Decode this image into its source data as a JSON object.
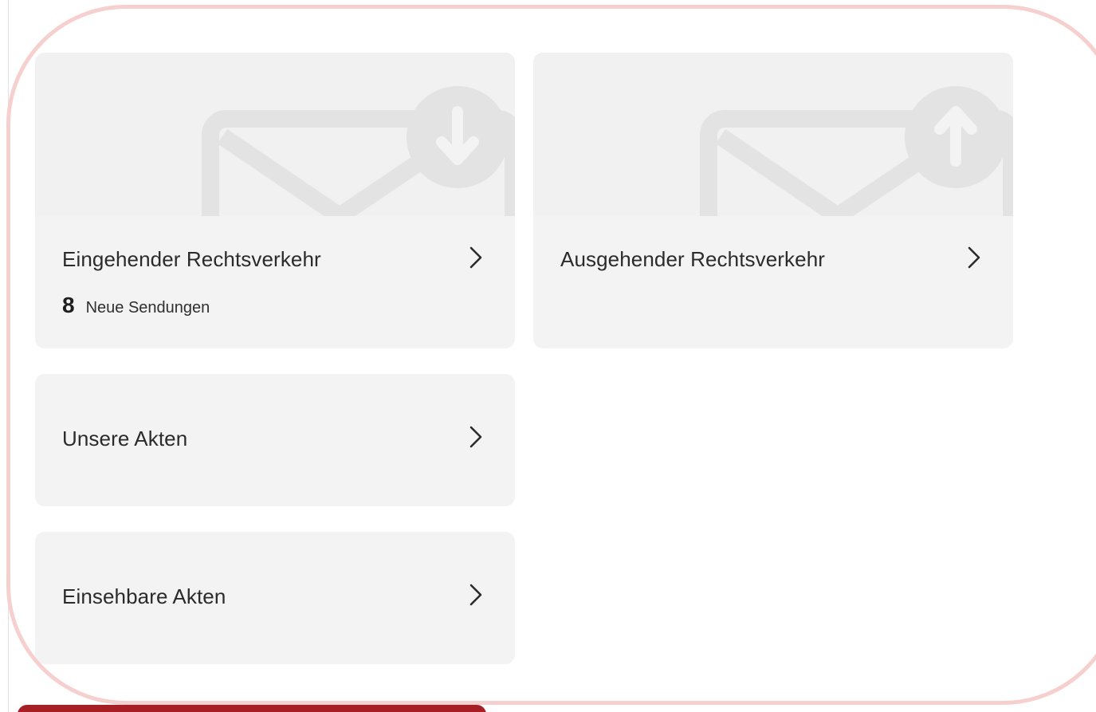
{
  "tiles": {
    "incoming": {
      "label": "Eingehender Rechtsverkehr",
      "count": "8",
      "count_label": "Neue Sendungen",
      "icon": "mail-incoming-icon"
    },
    "outgoing": {
      "label": "Ausgehender Rechtsverkehr",
      "icon": "mail-outgoing-icon"
    },
    "our_files": {
      "label": "Unsere Akten"
    },
    "viewable_files": {
      "label": "Einsehbare Akten"
    }
  },
  "colors": {
    "tile_background": "#f3f3f3",
    "icon_color": "#e3e3e3",
    "focus_frame": "#f6d0cf",
    "accent": "#a51f24"
  }
}
